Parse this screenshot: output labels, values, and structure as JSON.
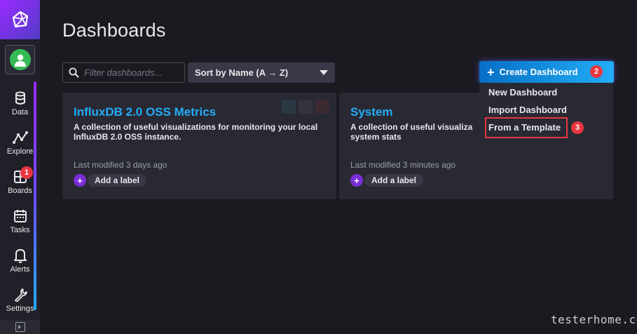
{
  "sidebar": {
    "items": [
      {
        "label": "Data",
        "icon": "database-icon"
      },
      {
        "label": "Explore",
        "icon": "graph-icon"
      },
      {
        "label": "Boards",
        "icon": "dashboards-icon"
      },
      {
        "label": "Tasks",
        "icon": "calendar-icon"
      },
      {
        "label": "Alerts",
        "icon": "bell-icon"
      },
      {
        "label": "Settings",
        "icon": "wrench-icon"
      }
    ]
  },
  "header": {
    "title": "Dashboards"
  },
  "toolbar": {
    "search_placeholder": "Filter dashboards...",
    "sort_label": "Sort by Name (A → Z)",
    "create_label": "Create Dashboard"
  },
  "create_menu": {
    "items": [
      "New Dashboard",
      "Import Dashboard",
      "From a Template"
    ]
  },
  "annotations": {
    "badge1": "1",
    "badge2": "2",
    "badge3": "3"
  },
  "dashboards": [
    {
      "title": "InfluxDB 2.0 OSS Metrics",
      "description_line1": "A collection of useful visualizations for monitoring your local",
      "description_line2": "InfluxDB 2.0 OSS instance.",
      "modified": "Last modified 3 days ago",
      "label_button": "Add a label"
    },
    {
      "title": "System",
      "description_line1": "A collection of useful visualiza",
      "description_line2": "system stats",
      "modified": "Last modified 3 minutes ago",
      "label_button": "Add a label"
    }
  ],
  "watermark": "testerhome.com",
  "colors": {
    "accent": "#22adf6",
    "brand": "#9b2aff",
    "badge": "#e8363f"
  }
}
